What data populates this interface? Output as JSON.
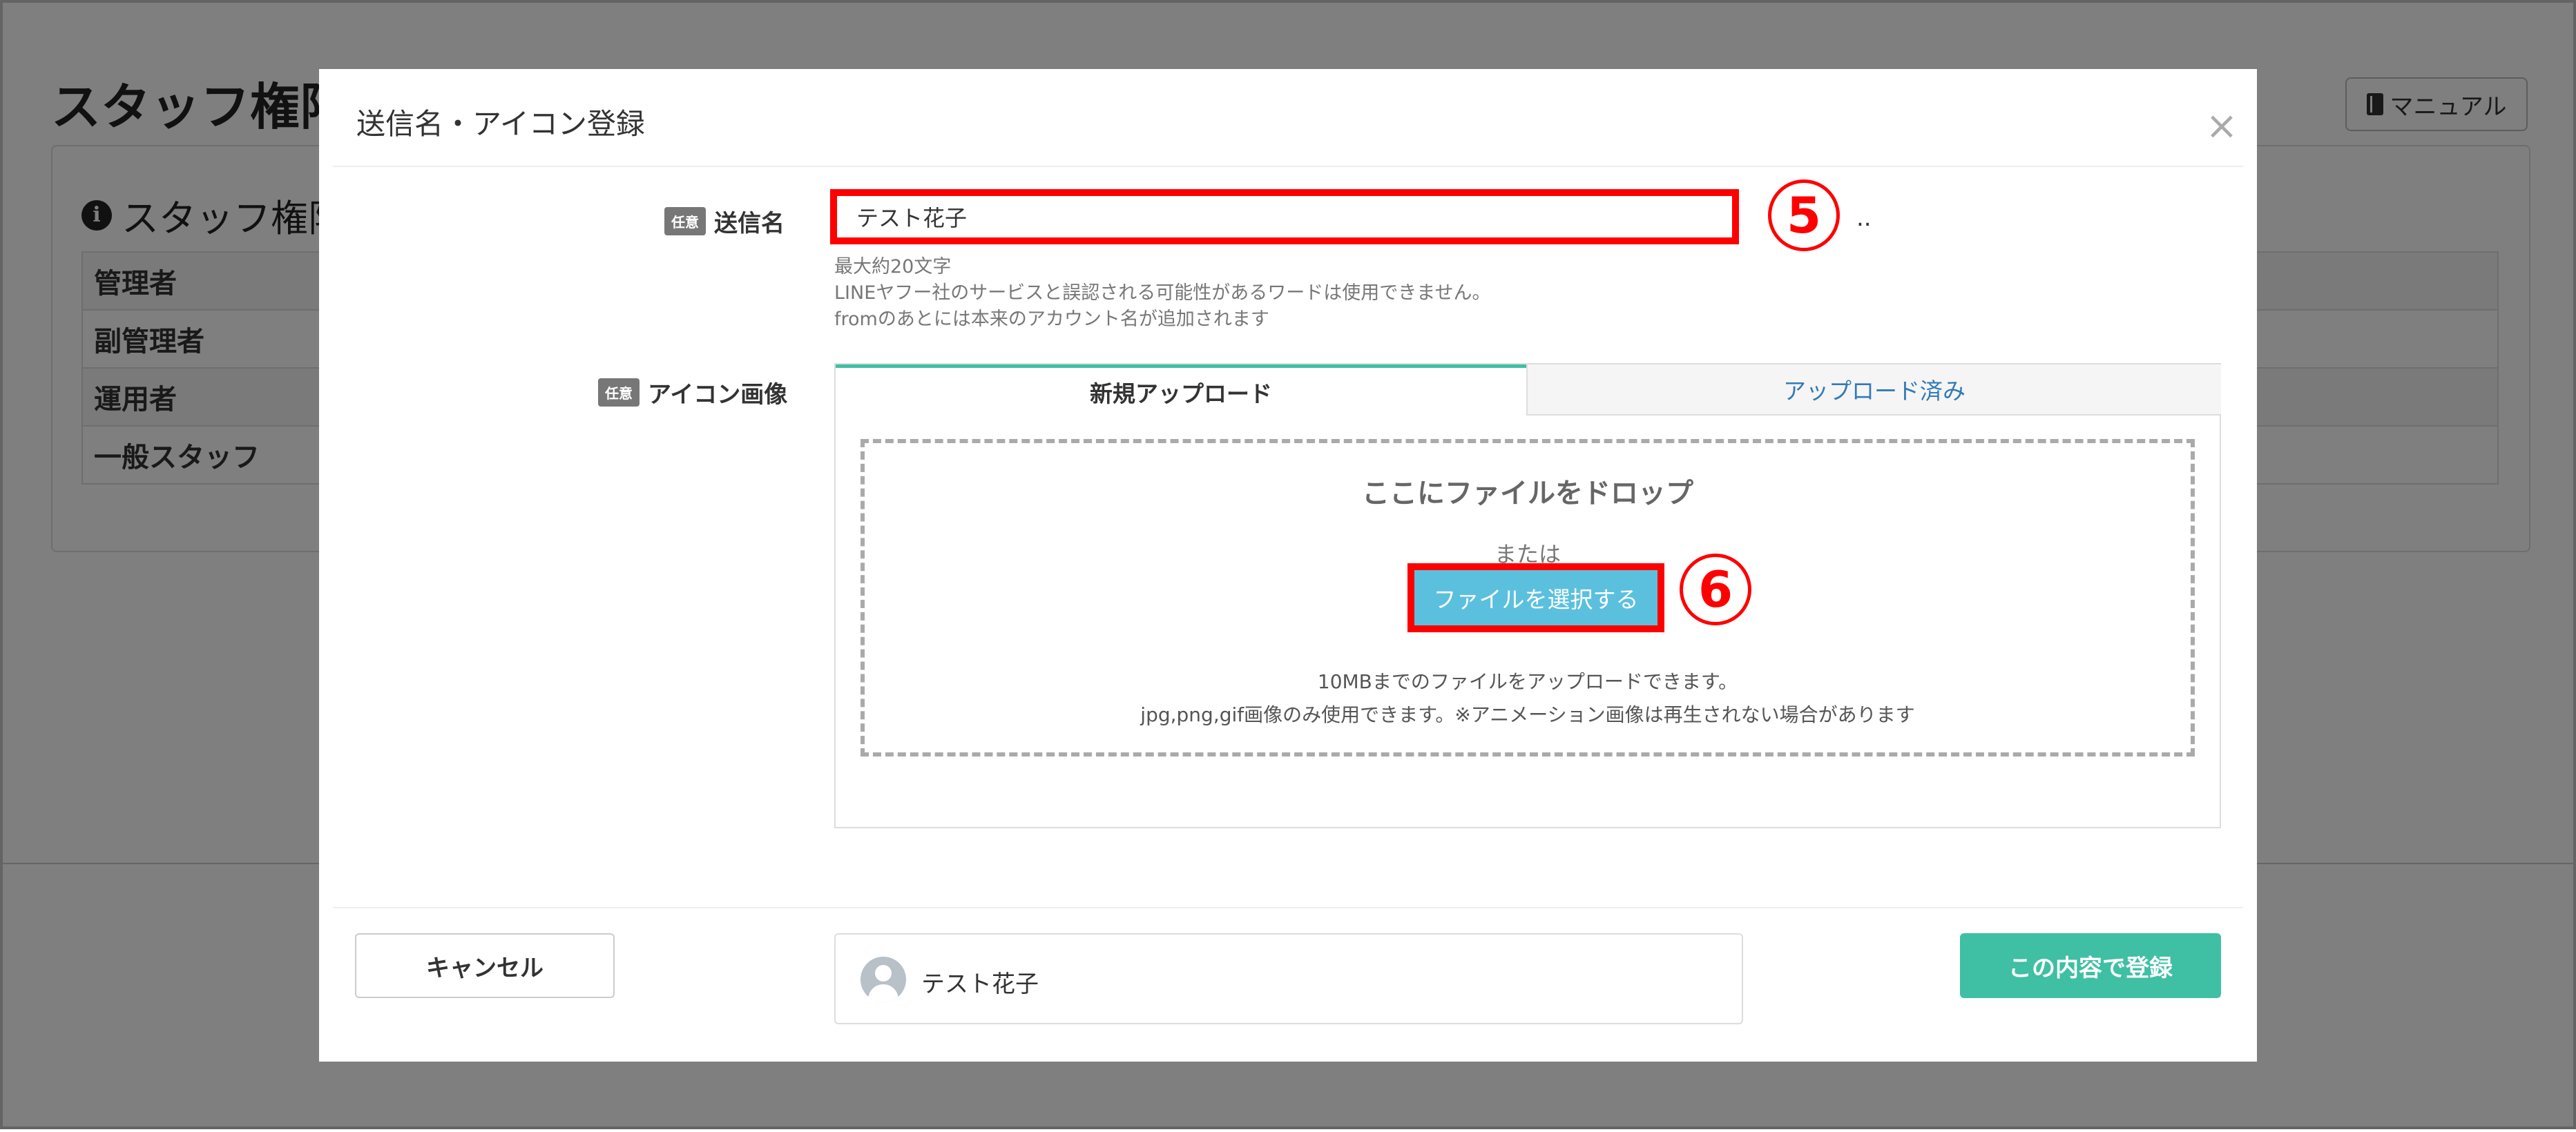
{
  "background": {
    "page_title": "スタッフ権限",
    "manual_button": "マニュアル",
    "panel_title": "スタッフ権限",
    "roles": [
      "管理者",
      "副管理者",
      "運用者",
      "一般スタッフ"
    ]
  },
  "modal": {
    "title": "送信名・アイコン登録",
    "close_symbol": "×",
    "optional_badge": "任意",
    "sender": {
      "label": "送信名",
      "value": "テスト花子",
      "marker": "5",
      "trailing": "..",
      "help": [
        "最大約20文字",
        "LINEヤフー社のサービスと誤認される可能性があるワードは使用できません。",
        "fromのあとには本来のアカウント名が追加されます"
      ]
    },
    "icon": {
      "label": "アイコン画像",
      "tabs": {
        "new_upload": "新規アップロード",
        "uploaded": "アップロード済み"
      },
      "drop_title": "ここにファイルをドロップ",
      "or_text": "または",
      "select_button": "ファイルを選択する",
      "marker": "6",
      "note_size": "10MBまでのファイルをアップロードできます。",
      "note_format": "jpg,png,gif画像のみ使用できます。※アニメーション画像は再生されない場合があります"
    },
    "footer": {
      "cancel": "キャンセル",
      "preview_name": "テスト花子",
      "submit": "この内容で登録"
    }
  },
  "colors": {
    "accent": "#3fbfa3",
    "highlight": "#ff0000",
    "file_button": "#5bc0de",
    "link": "#337ab7"
  }
}
